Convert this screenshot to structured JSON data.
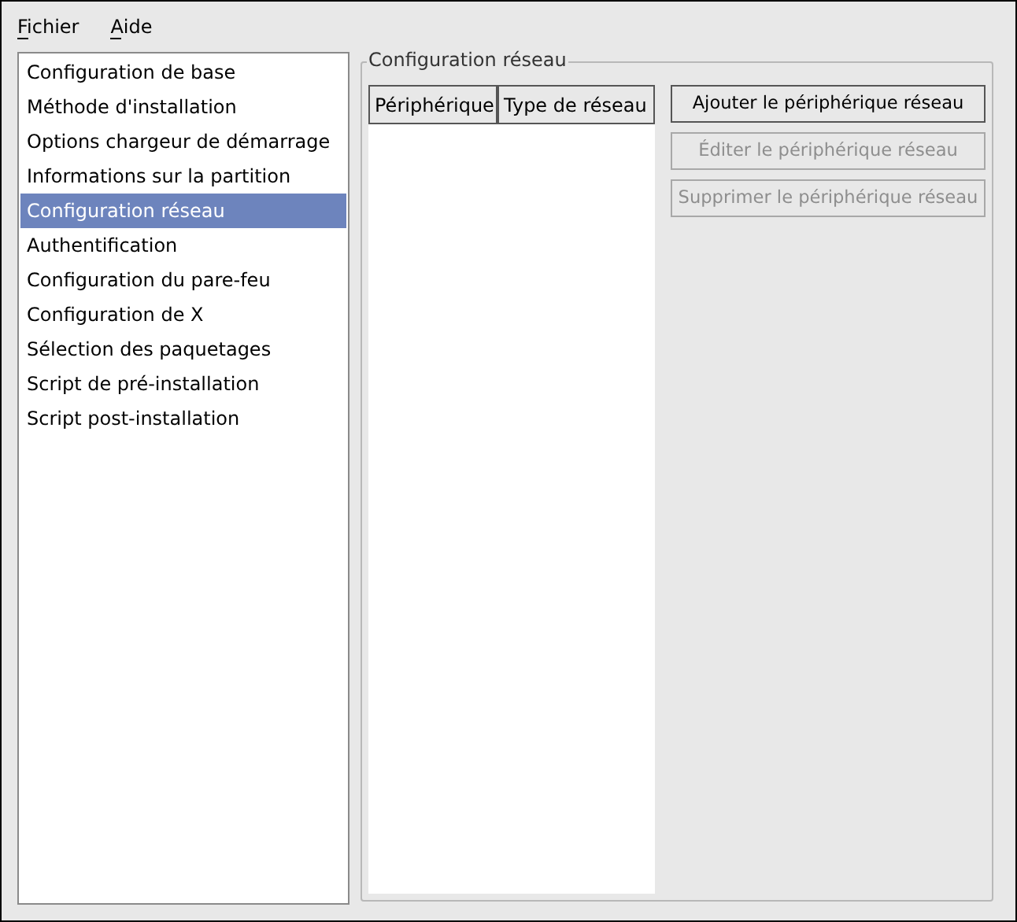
{
  "menu": [
    {
      "label": "Fichier"
    },
    {
      "label": "Aide"
    }
  ],
  "sidebar": {
    "items": [
      {
        "label": "Configuration de base",
        "selected": false
      },
      {
        "label": "Méthode d'installation",
        "selected": false
      },
      {
        "label": "Options chargeur de démarrage",
        "selected": false
      },
      {
        "label": "Informations sur la partition",
        "selected": false
      },
      {
        "label": "Configuration réseau",
        "selected": true
      },
      {
        "label": "Authentification",
        "selected": false
      },
      {
        "label": "Configuration du pare-feu",
        "selected": false
      },
      {
        "label": "Configuration de X",
        "selected": false
      },
      {
        "label": "Sélection des paquetages",
        "selected": false
      },
      {
        "label": "Script de pré-installation",
        "selected": false
      },
      {
        "label": "Script post-installation",
        "selected": false
      }
    ]
  },
  "panel": {
    "title": "Configuration réseau",
    "table": {
      "columns": [
        "Périphérique",
        "Type de réseau"
      ]
    },
    "buttons": [
      {
        "label": "Ajouter le périphérique réseau",
        "disabled": false
      },
      {
        "label": "Éditer le périphérique réseau",
        "disabled": true
      },
      {
        "label": "Supprimer le périphérique réseau",
        "disabled": true
      }
    ]
  }
}
